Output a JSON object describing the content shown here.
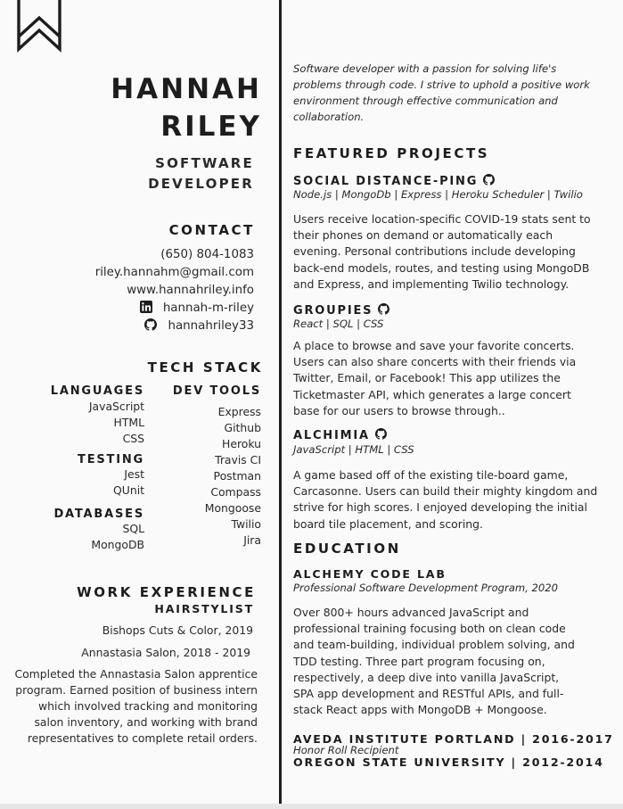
{
  "header": {
    "first_name": "HANNAH",
    "last_name": "RILEY",
    "title_line1": "SOFTWARE",
    "title_line2": "DEVELOPER"
  },
  "contact": {
    "heading": "CONTACT",
    "phone": "(650) 804-1083",
    "email": "riley.hannahm@gmail.com",
    "website": "www.hannahriley.info",
    "linkedin": "hannah-m-riley",
    "github": "hannahriley33"
  },
  "tech_stack": {
    "heading": "TECH STACK",
    "languages": {
      "heading": "LANGUAGES",
      "items": [
        "JavaScript",
        "HTML",
        "CSS"
      ]
    },
    "testing": {
      "heading": "TESTING",
      "items": [
        "Jest",
        "QUnit"
      ]
    },
    "databases": {
      "heading": "DATABASES",
      "items": [
        "SQL",
        "MongoDB"
      ]
    },
    "dev_tools": {
      "heading": "DEV TOOLS",
      "items": [
        "Express",
        "Github",
        "Heroku",
        "Travis CI",
        "Postman",
        "Compass",
        "Mongoose",
        "Twilio",
        "Jira"
      ]
    }
  },
  "work": {
    "heading": "WORK EXPERIENCE",
    "role": "HAIRSTYLIST",
    "place1": "Bishops Cuts & Color, 2019",
    "place2": "Annastasia Salon, 2018 - 2019",
    "description": "Completed the Annastasia Salon apprentice program. Earned position of business intern which involved tracking and monitoring salon inventory, and working with brand representatives to complete retail orders."
  },
  "intro": "Software developer with a passion for solving life's problems through code. I strive to uphold a positive work environment through effective communication and collaboration.",
  "projects": {
    "heading": "FEATURED PROJECTS",
    "items": [
      {
        "title": "SOCIAL DISTANCE-PING",
        "tech": "Node.js | MongoDb | Express | Heroku Scheduler | Twilio",
        "description": "Users receive location-specific COVID-19 stats sent to their phones on demand or automatically each evening. Personal contributions include developing back-end models, routes, and testing using MongoDB and Express, and implementing Twilio technology."
      },
      {
        "title": "GROUPIES",
        "tech": "React | SQL | CSS",
        "description": "A place to browse and save your favorite concerts. Users can also share concerts with their friends via Twitter, Email, or Facebook! This app utilizes the Ticketmaster API, which generates a large concert base for our users to browse through.."
      },
      {
        "title": "ALCHIMIA",
        "tech": "JavaScript | HTML | CSS",
        "description": "A game based off of the existing tile-board game, Carcasonne. Users can build their mighty kingdom and strive for high scores. I enjoyed developing the initial board tile placement, and scoring."
      }
    ]
  },
  "education": {
    "heading": "EDUCATION",
    "alchemy": {
      "name": "ALCHEMY CODE LAB",
      "program": "Professional Software Development Program, 2020",
      "description": "Over 800+ hours advanced JavaScript and professional training focusing both on clean code and team-building, individual problem solving, and TDD testing. Three part program focusing on, respectively, a deep dive into vanilla JavaScript, SPA app development and RESTful APIs, and full-stack React apps with MongoDB + Mongoose."
    },
    "aveda": {
      "name": "AVEDA INSTITUTE PORTLAND | 2016-2017",
      "note": "Honor Roll Recipient"
    },
    "osu": {
      "name": "OREGON STATE UNIVERSITY | 2012-2014"
    }
  },
  "icons": {
    "bookmark": "bookmark-icon",
    "linkedin": "linkedin-icon",
    "github": "github-icon"
  },
  "colors": {
    "text": "#1d1d1d",
    "divider": "#1c1c1c",
    "background": "#fafafa"
  }
}
